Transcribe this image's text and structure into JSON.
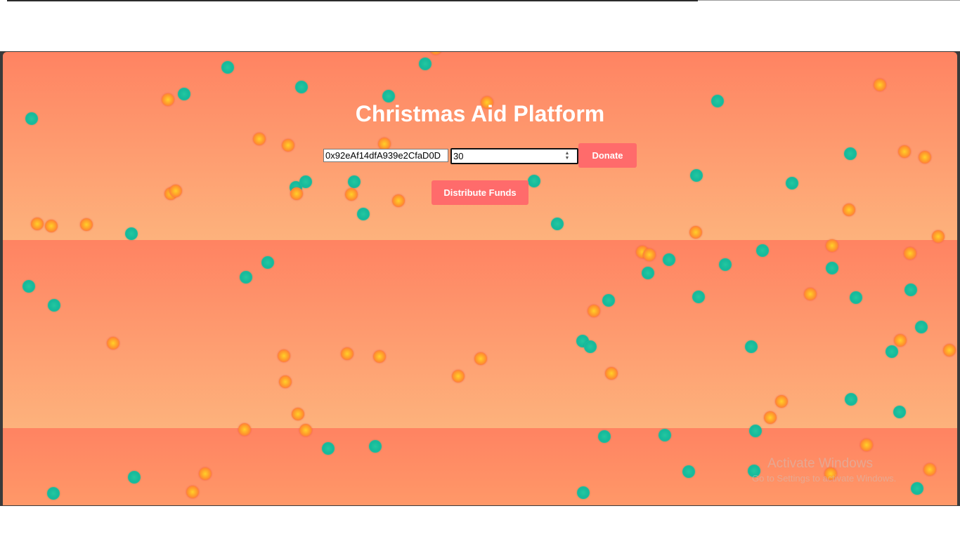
{
  "page": {
    "title": "Christmas Aid Platform"
  },
  "form": {
    "address_value": "0x92eAf14dfA939e2CfaD0D",
    "amount_value": "30",
    "donate_label": "Donate",
    "distribute_label": "Distribute Funds"
  },
  "watermark": {
    "title": "Activate Windows",
    "subtitle": "Go to Settings to activate Windows."
  },
  "colors": {
    "background_top": "#ff8362",
    "background_bottom": "#fdb27c",
    "button": "#ff6b6b",
    "dot_green": "#1ebf9d",
    "dot_orange": "#ff9f2a"
  },
  "icons": {
    "spinner": "number-spinner-icon"
  }
}
